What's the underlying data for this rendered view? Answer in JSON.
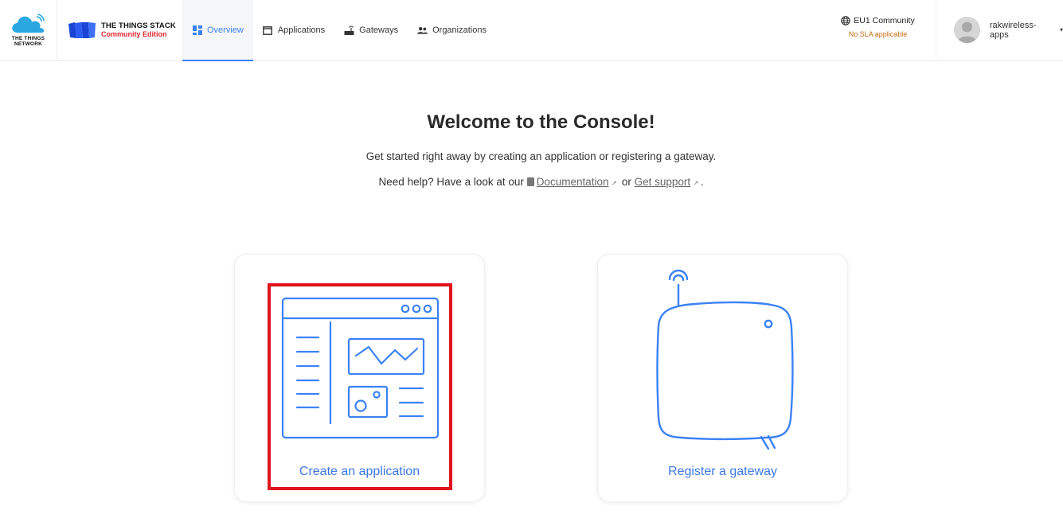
{
  "brand": {
    "ttn_line1": "THE THINGS",
    "ttn_line2": "NETWORK",
    "tts_title": "THE THINGS STACK",
    "tts_edition": "Community Edition"
  },
  "nav": {
    "items": [
      {
        "label": "Overview",
        "icon": "dashboard-icon",
        "active": true
      },
      {
        "label": "Applications",
        "icon": "window-icon",
        "active": false
      },
      {
        "label": "Gateways",
        "icon": "router-icon",
        "active": false
      },
      {
        "label": "Organizations",
        "icon": "group-icon",
        "active": false
      }
    ]
  },
  "cluster": {
    "name": "EU1 Community",
    "sla": "No SLA applicable",
    "icon": "globe-icon"
  },
  "user": {
    "name": "rakwireless-apps",
    "caret": "▾"
  },
  "main": {
    "title": "Welcome to the Console!",
    "subtitle": "Get started right away by creating an application or registering a gateway.",
    "help_prefix": "Need help? Have a look at our",
    "documentation_link": "Documentation",
    "or_text": "or",
    "support_link": "Get support",
    "help_suffix": "."
  },
  "cards": {
    "create_application": "Create an application",
    "register_gateway": "Register a gateway"
  },
  "colors": {
    "accent": "#3b82f6",
    "illustration": "#3b82f6",
    "highlight": "#e1141e",
    "sla": "#c56a12"
  }
}
